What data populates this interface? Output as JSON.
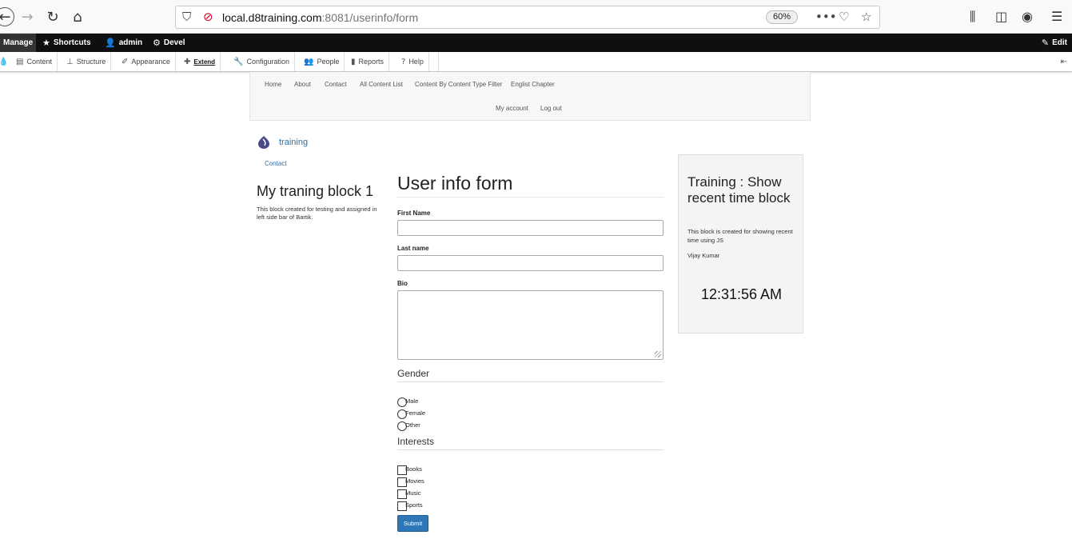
{
  "browser": {
    "url_host": "local.d8training.com",
    "url_rest": ":8081/userinfo/form",
    "zoom": "60%"
  },
  "toolbar": {
    "manage": "Manage",
    "shortcuts": "Shortcuts",
    "user": "admin",
    "devel": "Devel",
    "edit": "Edit"
  },
  "tray": {
    "content": "Content",
    "structure": "Structure",
    "appearance": "Appearance",
    "extend": "Extend",
    "configuration": "Configuration",
    "people": "People",
    "reports": "Reports",
    "help": "Help"
  },
  "nav": {
    "main": [
      "Home",
      "About",
      "Contact",
      "All Content List",
      "Content By Content Type Filter",
      "Englist Chapter"
    ],
    "account": "My account",
    "logout": "Log out"
  },
  "site": {
    "name": "training",
    "breadcrumb": "Contact"
  },
  "left_block": {
    "title": "My traning block 1",
    "body": "This block created for testing and assigned in left side bar of Bartik."
  },
  "form": {
    "title": "User info form",
    "first_name_label": "First Name",
    "last_name_label": "Last name",
    "bio_label": "Bio",
    "gender_legend": "Gender",
    "gender_options": [
      "Male",
      "Female",
      "Other"
    ],
    "interests_legend": "Interests",
    "interest_options": [
      "Books",
      "Movies",
      "Music",
      "Sports"
    ],
    "submit": "Submit"
  },
  "right_block": {
    "title": "Training : Show recent time block",
    "body": "This block is created for showing recent time using JS",
    "author": "Vijay Kumar",
    "time": "12:31:56 AM"
  },
  "colors": {
    "link": "#2f6fa3",
    "button": "#2f78b8",
    "toolbar": "#0f0f0f"
  }
}
